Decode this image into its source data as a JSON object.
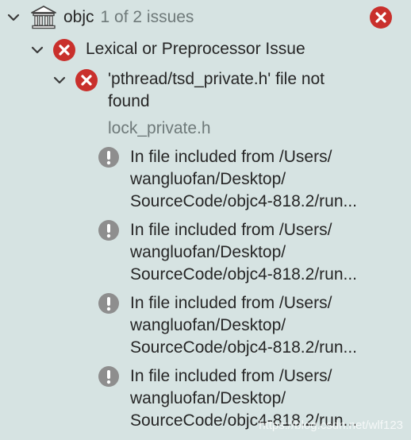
{
  "project": {
    "name": "objc",
    "issue_count": "1 of 2 issues"
  },
  "category": {
    "label": "Lexical or Preprocessor Issue"
  },
  "error": {
    "line1": "'pthread/tsd_private.h' file not",
    "line2": "found",
    "file": "lock_private.h"
  },
  "notes": [
    {
      "line1": "In file included from /Users/",
      "line2": "wangluofan/Desktop/",
      "line3": "SourceCode/objc4-818.2/run..."
    },
    {
      "line1": "In file included from /Users/",
      "line2": "wangluofan/Desktop/",
      "line3": "SourceCode/objc4-818.2/run..."
    },
    {
      "line1": "In file included from /Users/",
      "line2": "wangluofan/Desktop/",
      "line3": "SourceCode/objc4-818.2/run..."
    },
    {
      "line1": "In file included from /Users/",
      "line2": "wangluofan/Desktop/",
      "line3": "SourceCode/objc4-818.2/run..."
    }
  ],
  "watermark": "https://blog.csdn.net/wlf123",
  "colors": {
    "background": "#d6e3e2",
    "error_red": "#c9302c",
    "warning_gray": "#8e8e8e",
    "secondary_text": "#6f7a7a"
  },
  "icons": {
    "disclosure": "chevron-down-icon",
    "project": "bank-building-icon",
    "error": "error-x-icon",
    "note": "exclamation-icon"
  }
}
